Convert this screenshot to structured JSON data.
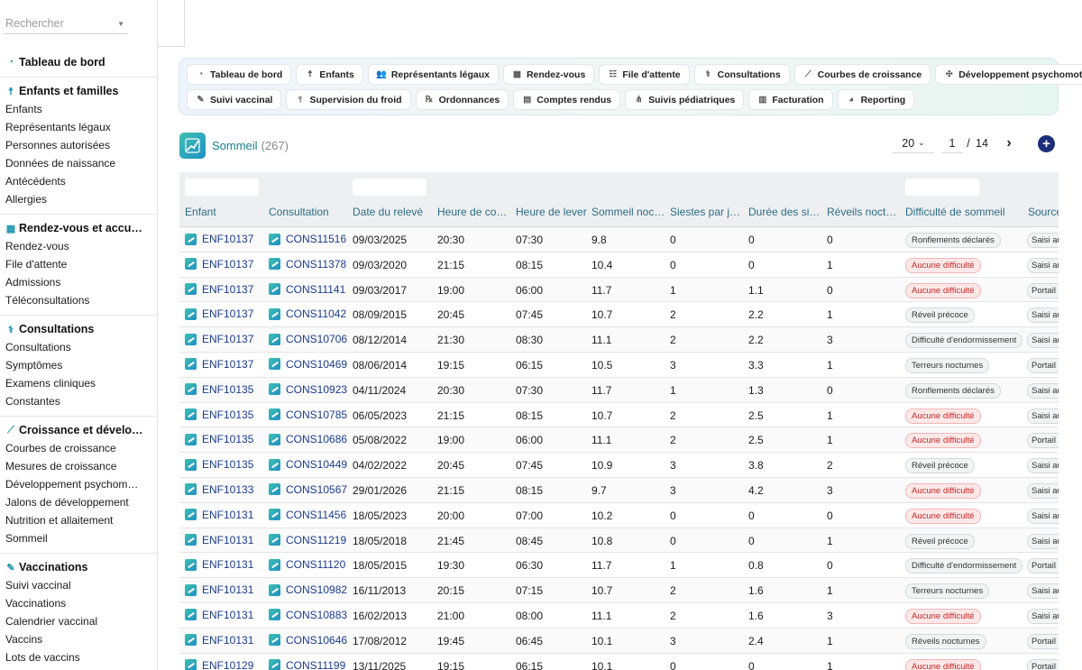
{
  "search": {
    "placeholder": "Rechercher"
  },
  "sidebar": {
    "dashboard": "Tableau de bord",
    "groups": [
      {
        "title": "Enfants et familles",
        "icon": "child-icon",
        "items": [
          "Enfants",
          "Représentants légaux",
          "Personnes autorisées",
          "Données de naissance",
          "Antécédents",
          "Allergies"
        ]
      },
      {
        "title": "Rendez-vous et accu…",
        "icon": "calendar-icon",
        "items": [
          "Rendez-vous",
          "File d'attente",
          "Admissions",
          "Téléconsultations"
        ]
      },
      {
        "title": "Consultations",
        "icon": "stethoscope-icon",
        "items": [
          "Consultations",
          "Symptômes",
          "Examens cliniques",
          "Constantes"
        ]
      },
      {
        "title": "Croissance et dévelo…",
        "icon": "chart-line-icon",
        "items": [
          "Courbes de croissance",
          "Mesures de croissance",
          "Développement psychom…",
          "Jalons de développement",
          "Nutrition et allaitement",
          "Sommeil"
        ]
      },
      {
        "title": "Vaccinations",
        "icon": "syringe-icon",
        "items": [
          "Suivi vaccinal",
          "Vaccinations",
          "Calendrier vaccinal",
          "Vaccins",
          "Lots de vaccins"
        ]
      }
    ]
  },
  "module_nav": {
    "row1": [
      {
        "label": "Tableau de bord",
        "icon": "gauge-icon",
        "glyph": "◔"
      },
      {
        "label": "Enfants",
        "icon": "child-icon",
        "glyph": "☨"
      },
      {
        "label": "Représentants légaux",
        "icon": "users-icon",
        "glyph": "👥"
      },
      {
        "label": "Rendez-vous",
        "icon": "calendar-icon",
        "glyph": "▦"
      },
      {
        "label": "File d'attente",
        "icon": "queue-icon",
        "glyph": "☷"
      },
      {
        "label": "Consultations",
        "icon": "stethoscope-icon",
        "glyph": "⚕"
      },
      {
        "label": "Courbes de croissance",
        "icon": "chart-line-icon",
        "glyph": "⟋"
      },
      {
        "label": "Développement psychomoteur",
        "icon": "puzzle-icon",
        "glyph": "✣"
      }
    ],
    "row2": [
      {
        "label": "Suivi vaccinal",
        "icon": "syringe-icon",
        "glyph": "✎"
      },
      {
        "label": "Supervision du froid",
        "icon": "thermometer-icon",
        "glyph": "⫯"
      },
      {
        "label": "Ordonnances",
        "icon": "prescription-icon",
        "glyph": "℞"
      },
      {
        "label": "Comptes rendus",
        "icon": "document-icon",
        "glyph": "▤"
      },
      {
        "label": "Suivis pédiatriques",
        "icon": "network-icon",
        "glyph": "⋔"
      },
      {
        "label": "Facturation",
        "icon": "invoice-icon",
        "glyph": "▥"
      },
      {
        "label": "Reporting",
        "icon": "pie-chart-icon",
        "glyph": "◕"
      }
    ]
  },
  "page": {
    "title": "Sommeil",
    "count": "(267)"
  },
  "pagination": {
    "page_size": "20",
    "current": "1",
    "separator": "/",
    "total": "14"
  },
  "table": {
    "headers": [
      "Enfant",
      "Consultation",
      "Date du relevé",
      "Heure de co…",
      "Heure de lever",
      "Sommeil noc…",
      "Siestes par j…",
      "Durée des si…",
      "Réveils noct…",
      "Difficulté de sommeil",
      "Source"
    ],
    "rows": [
      {
        "enfant": "ENF10137",
        "consultation": "CONS11516",
        "date": "09/03/2025",
        "coucher": "20:30",
        "lever": "07:30",
        "sommeil": "9.8",
        "siestes": "0",
        "duree": "0",
        "reveils": "0",
        "difficulte": "Ronflements déclarés",
        "alert": false,
        "source": "Saisi au cabinet"
      },
      {
        "enfant": "ENF10137",
        "consultation": "CONS11378",
        "date": "09/03/2020",
        "coucher": "21:15",
        "lever": "08:15",
        "sommeil": "10.4",
        "siestes": "0",
        "duree": "0",
        "reveils": "1",
        "difficulte": "Aucune difficulté",
        "alert": true,
        "source": "Saisi au cabinet"
      },
      {
        "enfant": "ENF10137",
        "consultation": "CONS11141",
        "date": "09/03/2017",
        "coucher": "19:00",
        "lever": "06:00",
        "sommeil": "11.7",
        "siestes": "1",
        "duree": "1.1",
        "reveils": "0",
        "difficulte": "Aucune difficulté",
        "alert": true,
        "source": "Portail"
      },
      {
        "enfant": "ENF10137",
        "consultation": "CONS11042",
        "date": "08/09/2015",
        "coucher": "20:45",
        "lever": "07:45",
        "sommeil": "10.7",
        "siestes": "2",
        "duree": "2.2",
        "reveils": "1",
        "difficulte": "Réveil précoce",
        "alert": false,
        "source": "Saisi au cabinet"
      },
      {
        "enfant": "ENF10137",
        "consultation": "CONS10706",
        "date": "08/12/2014",
        "coucher": "21:30",
        "lever": "08:30",
        "sommeil": "11.1",
        "siestes": "2",
        "duree": "2.2",
        "reveils": "3",
        "difficulte": "Difficulté d'endormissement",
        "alert": false,
        "source": "Saisi au cabinet"
      },
      {
        "enfant": "ENF10137",
        "consultation": "CONS10469",
        "date": "08/06/2014",
        "coucher": "19:15",
        "lever": "06:15",
        "sommeil": "10.5",
        "siestes": "3",
        "duree": "3.3",
        "reveils": "1",
        "difficulte": "Terreurs nocturnes",
        "alert": false,
        "source": "Portail"
      },
      {
        "enfant": "ENF10135",
        "consultation": "CONS10923",
        "date": "04/11/2024",
        "coucher": "20:30",
        "lever": "07:30",
        "sommeil": "11.7",
        "siestes": "1",
        "duree": "1.3",
        "reveils": "0",
        "difficulte": "Ronflements déclarés",
        "alert": false,
        "source": "Saisi au cabinet"
      },
      {
        "enfant": "ENF10135",
        "consultation": "CONS10785",
        "date": "06/05/2023",
        "coucher": "21:15",
        "lever": "08:15",
        "sommeil": "10.7",
        "siestes": "2",
        "duree": "2.5",
        "reveils": "1",
        "difficulte": "Aucune difficulté",
        "alert": true,
        "source": "Saisi au cabinet"
      },
      {
        "enfant": "ENF10135",
        "consultation": "CONS10686",
        "date": "05/08/2022",
        "coucher": "19:00",
        "lever": "06:00",
        "sommeil": "11.1",
        "siestes": "2",
        "duree": "2.5",
        "reveils": "1",
        "difficulte": "Aucune difficulté",
        "alert": true,
        "source": "Portail"
      },
      {
        "enfant": "ENF10135",
        "consultation": "CONS10449",
        "date": "04/02/2022",
        "coucher": "20:45",
        "lever": "07:45",
        "sommeil": "10.9",
        "siestes": "3",
        "duree": "3.8",
        "reveils": "2",
        "difficulte": "Réveil précoce",
        "alert": false,
        "source": "Saisi au cabinet"
      },
      {
        "enfant": "ENF10133",
        "consultation": "CONS10567",
        "date": "29/01/2026",
        "coucher": "21:15",
        "lever": "08:15",
        "sommeil": "9.7",
        "siestes": "3",
        "duree": "4.2",
        "reveils": "3",
        "difficulte": "Aucune difficulté",
        "alert": true,
        "source": "Saisi au cabinet"
      },
      {
        "enfant": "ENF10131",
        "consultation": "CONS11456",
        "date": "18/05/2023",
        "coucher": "20:00",
        "lever": "07:00",
        "sommeil": "10.2",
        "siestes": "0",
        "duree": "0",
        "reveils": "0",
        "difficulte": "Aucune difficulté",
        "alert": true,
        "source": "Saisi au cabinet"
      },
      {
        "enfant": "ENF10131",
        "consultation": "CONS11219",
        "date": "18/05/2018",
        "coucher": "21:45",
        "lever": "08:45",
        "sommeil": "10.8",
        "siestes": "0",
        "duree": "0",
        "reveils": "1",
        "difficulte": "Réveil précoce",
        "alert": false,
        "source": "Saisi au cabinet"
      },
      {
        "enfant": "ENF10131",
        "consultation": "CONS11120",
        "date": "18/05/2015",
        "coucher": "19:30",
        "lever": "06:30",
        "sommeil": "11.7",
        "siestes": "1",
        "duree": "0.8",
        "reveils": "0",
        "difficulte": "Difficulté d'endormissement",
        "alert": false,
        "source": "Portail"
      },
      {
        "enfant": "ENF10131",
        "consultation": "CONS10982",
        "date": "16/11/2013",
        "coucher": "20:15",
        "lever": "07:15",
        "sommeil": "10.7",
        "siestes": "2",
        "duree": "1.6",
        "reveils": "1",
        "difficulte": "Terreurs nocturnes",
        "alert": false,
        "source": "Saisi au cabinet"
      },
      {
        "enfant": "ENF10131",
        "consultation": "CONS10883",
        "date": "16/02/2013",
        "coucher": "21:00",
        "lever": "08:00",
        "sommeil": "11.1",
        "siestes": "2",
        "duree": "1.6",
        "reveils": "3",
        "difficulte": "Aucune difficulté",
        "alert": true,
        "source": "Saisi au cabinet"
      },
      {
        "enfant": "ENF10131",
        "consultation": "CONS10646",
        "date": "17/08/2012",
        "coucher": "19:45",
        "lever": "06:45",
        "sommeil": "10.1",
        "siestes": "3",
        "duree": "2.4",
        "reveils": "1",
        "difficulte": "Réveils nocturnes",
        "alert": false,
        "source": "Portail"
      },
      {
        "enfant": "ENF10129",
        "consultation": "CONS11199",
        "date": "13/11/2025",
        "coucher": "19:15",
        "lever": "06:15",
        "sommeil": "10.1",
        "siestes": "0",
        "duree": "0",
        "reveils": "1",
        "difficulte": "Aucune difficulté",
        "alert": true,
        "source": "Portail"
      }
    ]
  },
  "colors": {
    "accent": "#1b7f8f",
    "link": "#1a3b8c",
    "add_button": "#1e2f7a",
    "alert_badge": "#c62828"
  }
}
